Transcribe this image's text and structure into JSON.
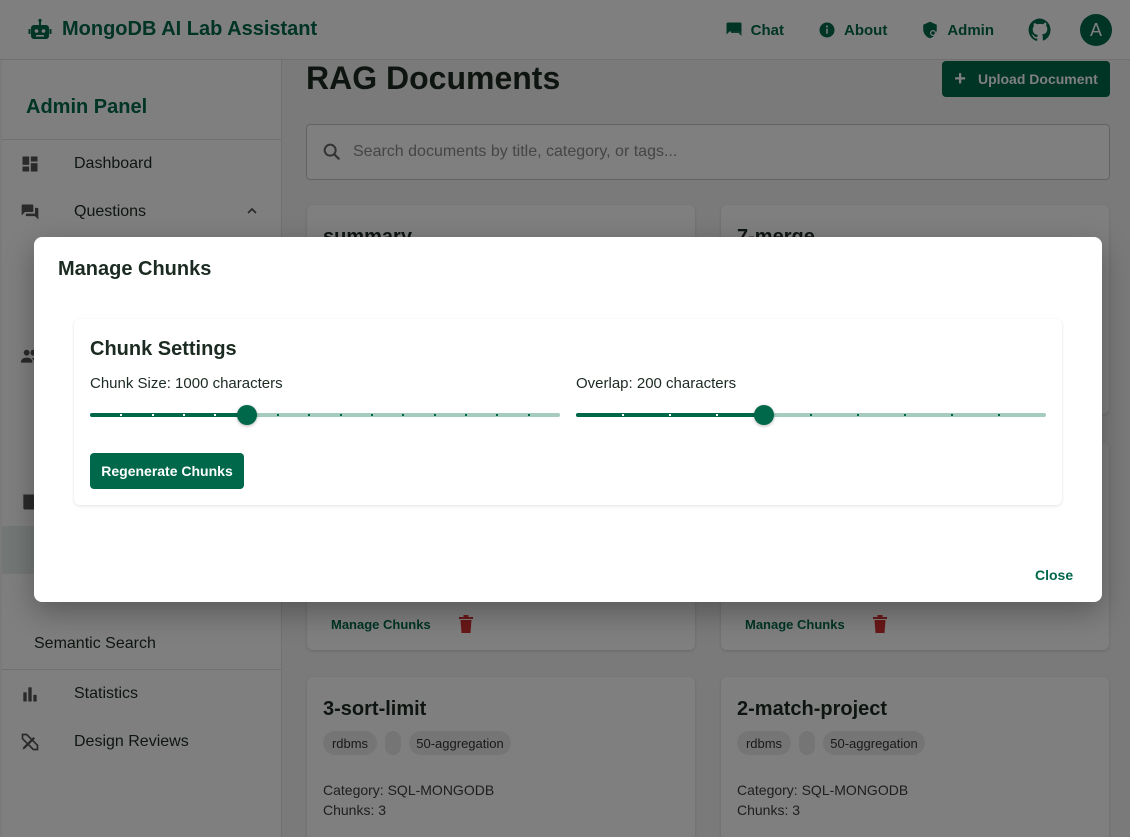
{
  "app": {
    "title": "MongoDB AI Lab Assistant",
    "nav": {
      "chat": "Chat",
      "about": "About",
      "admin": "Admin"
    },
    "avatar_initial": "A",
    "colors": {
      "primary": "#00684a",
      "danger": "#d32f2f"
    }
  },
  "sidebar": {
    "title": "Admin Panel",
    "items": [
      {
        "label": "Dashboard",
        "icon": "dashboard-icon"
      },
      {
        "label": "Questions",
        "icon": "forum-icon"
      },
      {
        "label": "Semantic Search",
        "icon": ""
      },
      {
        "label": "Statistics",
        "icon": "bar-chart-icon"
      },
      {
        "label": "Design Reviews",
        "icon": "design-tools-icon"
      }
    ]
  },
  "main": {
    "title": "RAG Documents",
    "upload_label": "Upload Document",
    "search_placeholder": "Search documents by title, category, or tags...",
    "cards": [
      {
        "title": "summary",
        "manage_label": "Manage Chunks"
      },
      {
        "title": "7-merge",
        "manage_label": "Manage Chunks"
      },
      {
        "title": "3-sort-limit",
        "tags": [
          "rdbms",
          "",
          "50-aggregation"
        ],
        "category": "Category: SQL-MONGODB",
        "chunks": "Chunks: 3"
      },
      {
        "title": "2-match-project",
        "tags": [
          "rdbms",
          "",
          "50-aggregation"
        ],
        "category": "Category: SQL-MONGODB",
        "chunks": "Chunks: 3"
      }
    ]
  },
  "dialog": {
    "title": "Manage Chunks",
    "settings_title": "Chunk Settings",
    "chunk_size_label": "Chunk Size: 1000 characters",
    "overlap_label": "Overlap: 200 characters",
    "chunk_size": {
      "value": 1000,
      "min": 0,
      "max": 3000,
      "step": 200
    },
    "overlap": {
      "value": 200,
      "min": 0,
      "max": 500,
      "step": 50
    },
    "regenerate_label": "Regenerate Chunks",
    "close_label": "Close"
  }
}
